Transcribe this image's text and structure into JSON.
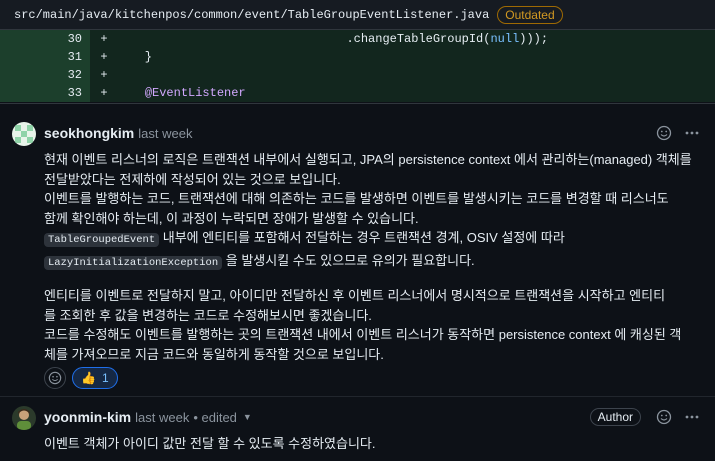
{
  "file": {
    "path": "src/main/java/kitchenpos/common/event/TableGroupEventListener.java",
    "badge": "Outdated"
  },
  "diff": {
    "lines": [
      {
        "num": "30",
        "sign": "+",
        "code_pre": "                                .changeTableGroupId(",
        "code_kw": "null",
        "code_post": ")));"
      },
      {
        "num": "31",
        "sign": "+",
        "code_pre": "    }",
        "code_kw": "",
        "code_post": ""
      },
      {
        "num": "32",
        "sign": "+",
        "code_pre": "",
        "code_kw": "",
        "code_post": ""
      },
      {
        "num": "33",
        "sign": "+",
        "code_pre": "    ",
        "code_kw": "",
        "code_post": "",
        "annotation": "@EventListener"
      }
    ]
  },
  "comments": [
    {
      "author": "seokhongkim",
      "time": "last week",
      "para1": [
        "현재 이벤트 리스너의 로직은 트랜잭션 내부에서 실행되고, JPA의 persistence context 에서 관리하는(managed) 객체를",
        "전달받았다는 전제하에 작성되어 있는 것으로 보입니다.",
        "이벤트를 발행하는 코드, 트랜잭션에 대해 의존하는 코드를 발생하면 이벤트를 발생시키는 코드를 변경할 때 리스너도",
        "함께 확인해야 하는데, 이 과정이 누락되면 장애가 발생할 수 있습니다."
      ],
      "chip1": "TableGroupedEvent",
      "chip1_text": " 내부에 엔티티를 포함해서 전달하는 경우 트랜잭션 경계, OSIV 설정에 따라",
      "chip2": "LazyInitializationException",
      "chip2_text": " 을 발생시킬 수도 있으므로 유의가 필요합니다.",
      "para2": [
        "엔티티를 이벤트로 전달하지 말고, 아이디만 전달하신 후 이벤트 리스너에서 명시적으로 트랜잭션을 시작하고 엔티티",
        "를 조회한 후 값을 변경하는 코드로 수정해보시면 좋겠습니다.",
        "코드를 수정해도 이벤트를 발행하는 곳의 트랜잭션 내에서 이벤트 리스너가 동작하면 persistence context 에 캐싱된 객",
        "체를 가져오므로 지금 코드와 동일하게 동작할 것으로 보입니다."
      ],
      "reaction_emoji": "👍",
      "reaction_count": "1"
    },
    {
      "author": "yoonmin-kim",
      "time": "last week",
      "edited": "• edited",
      "badge": "Author",
      "text": "이벤트 객체가 아이디 값만 전달 할 수 있도록 수정하였습니다."
    }
  ],
  "icons": {
    "emoji": "smiley-icon",
    "more": "kebab-horizontal-icon",
    "caret": "triangle-down-icon"
  },
  "colors": {
    "diff_added_bg": "#12261e",
    "badge_outdated": "#d29922",
    "reaction_active": "#1f6feb"
  }
}
